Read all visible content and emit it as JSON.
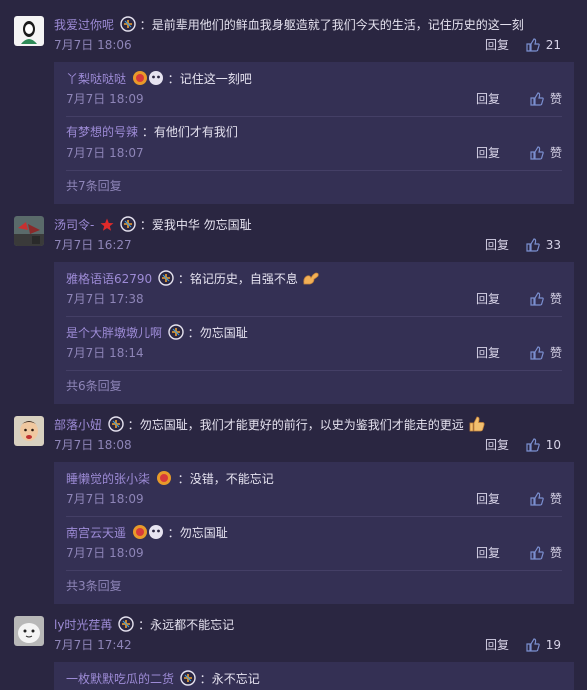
{
  "labels": {
    "reply": "回复",
    "like": "赞"
  },
  "colors": {
    "background": "#2a2641",
    "subbox": "#343054",
    "username": "#9d8bd6",
    "time": "#8e85b8"
  },
  "comments": [
    {
      "user": "我爱过你呢",
      "text": "是前辈用他们的鲜血我身躯造就了我们今天的生活，记住历史的这一刻",
      "time": "7月7日 18:06",
      "likes": "21",
      "replies": [
        {
          "user": "丫梨哒哒哒",
          "text": "记住这一刻吧",
          "time": "7月7日 18:09"
        },
        {
          "user": "有梦想的号辣",
          "text": "有他们才有我们",
          "time": "7月7日 18:07"
        }
      ],
      "more": "共7条回复"
    },
    {
      "user": "汤司令-",
      "text": "爱我中华 勿忘国耻",
      "time": "7月7日 16:27",
      "likes": "33",
      "replies": [
        {
          "user": "雅格语语62790",
          "text": "铭记历史，自强不息",
          "time": "7月7日 17:38"
        },
        {
          "user": "是个大胖墩墩儿啊",
          "text": "勿忘国耻",
          "time": "7月7日 18:14"
        }
      ],
      "more": "共6条回复"
    },
    {
      "user": "部落小妞",
      "text": "勿忘国耻，我们才能更好的前行，以史为鉴我们才能走的更远",
      "time": "7月7日 18:08",
      "likes": "10",
      "replies": [
        {
          "user": "睡懒觉的张小柒",
          "text": "没错，不能忘记",
          "time": "7月7日 18:09"
        },
        {
          "user": "南宫云天遥",
          "text": "勿忘国耻",
          "time": "7月7日 18:09"
        }
      ],
      "more": "共3条回复"
    },
    {
      "user": "ly时光荏苒",
      "text": "永远都不能忘记",
      "time": "7月7日 17:42",
      "likes": "19",
      "replies": [
        {
          "user": "一枚默默吃瓜的二货",
          "text": "永不忘记"
        }
      ]
    }
  ]
}
